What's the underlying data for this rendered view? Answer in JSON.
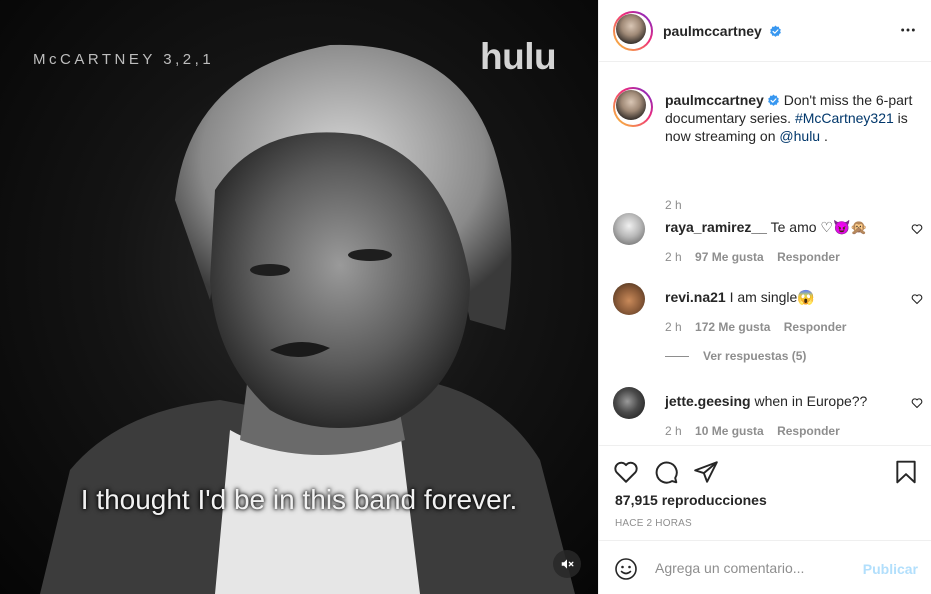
{
  "video": {
    "show_title": "McCARTNEY 3,2,1",
    "network_logo": "hulu",
    "subtitle": "I thought I'd be in this band forever.",
    "mute_icon": "speaker-muted-icon"
  },
  "post": {
    "author": "paulmccartney",
    "verified": true,
    "caption": {
      "text_before": "Don't miss the 6-part documentary series.",
      "hashtag": "#McCartney321",
      "text_middle": "is now streaming on",
      "mention": "@hulu",
      "text_after": ".",
      "time": "2 h"
    },
    "comments": [
      {
        "user": "raya_ramirez__",
        "text": "Te amo ♡😈🙊",
        "time": "2 h",
        "likes": "97 Me gusta",
        "reply": "Responder"
      },
      {
        "user": "revi.na21",
        "text": "I am single😱",
        "time": "2 h",
        "likes": "172 Me gusta",
        "reply": "Responder",
        "view_replies": "Ver respuestas (5)"
      },
      {
        "user": "jette.geesing",
        "text": "when in Europe??",
        "time": "2 h",
        "likes": "10 Me gusta",
        "reply": "Responder"
      }
    ],
    "views_count": "87,915",
    "views_label": "reproducciones",
    "time_ago": "HACE 2 HORAS",
    "comment_placeholder": "Agrega un comentario...",
    "publish_label": "Publicar"
  },
  "colors": {
    "link": "#00376b",
    "verified": "#3897f0",
    "muted_text": "#8e8e8e",
    "publish_disabled": "#b2dffc"
  }
}
